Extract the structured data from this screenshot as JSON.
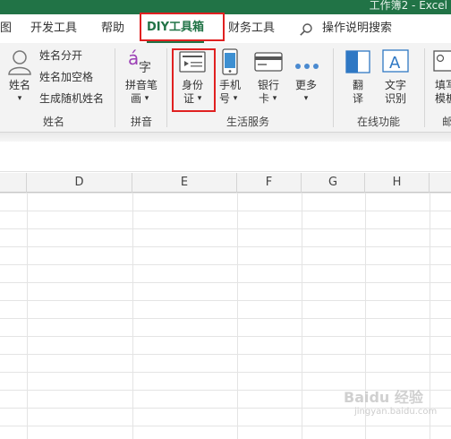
{
  "window": {
    "title": "工作簿2 - Excel"
  },
  "tabs": [
    {
      "label": "图"
    },
    {
      "label": "开发工具"
    },
    {
      "label": "帮助"
    },
    {
      "label": "DIY工具箱",
      "active": true
    },
    {
      "label": "财务工具"
    },
    {
      "label": "操作说明搜索"
    }
  ],
  "ribbon": {
    "name_group": {
      "label": "姓名",
      "big_button": "姓名",
      "items": [
        "姓名分开",
        "姓名加空格",
        "生成随机姓名"
      ]
    },
    "pinyin_group": {
      "label": "拼音",
      "button_line1": "拼音笔",
      "button_line2": "画"
    },
    "life_group": {
      "label": "生活服务",
      "id_line1": "身份",
      "id_line2": "证",
      "phone_line1": "手机",
      "phone_line2": "号",
      "bank_line1": "银行",
      "bank_line2": "卡",
      "more": "更多"
    },
    "online_group": {
      "label": "在线功能",
      "translate_line1": "翻",
      "translate_line2": "译",
      "ocr_line1": "文字",
      "ocr_line2": "识别"
    },
    "partial_group": {
      "label": "邮",
      "line1": "填写",
      "line2": "模板"
    }
  },
  "sheet": {
    "columns": [
      "D",
      "E",
      "F",
      "G",
      "H"
    ]
  },
  "watermark": {
    "main": "Baidu 经验",
    "sub": "jingyan.baidu.com"
  },
  "colors": {
    "excel_green": "#217346",
    "highlight_red": "#e02020"
  }
}
